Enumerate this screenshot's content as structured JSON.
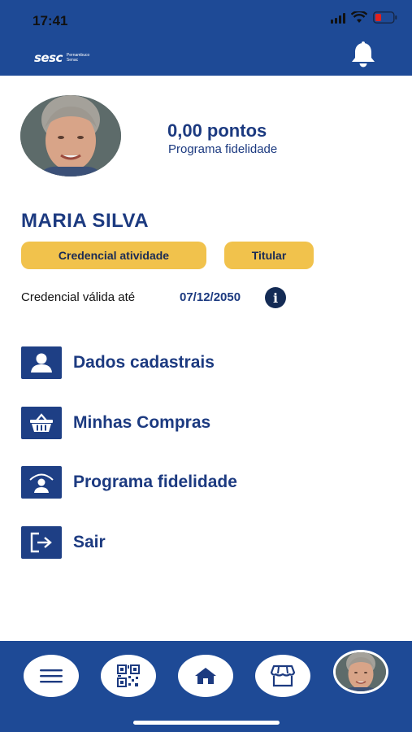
{
  "status_bar": {
    "time": "17:41"
  },
  "header": {
    "logo_word": "sesc",
    "logo_subtitle": "Pernambuco Senac"
  },
  "profile": {
    "points_value": "0,00 pontos",
    "points_label": "Programa fidelidade",
    "name": "MARIA SILVA",
    "badges": [
      "Credencial atividade",
      "Titular"
    ],
    "validity_label": "Credencial válida até",
    "validity_date": "07/12/2050",
    "info_icon": "i"
  },
  "menu": {
    "items": [
      {
        "label": "Dados cadastrais",
        "icon": "user-icon"
      },
      {
        "label": "Minhas Compras",
        "icon": "basket-icon"
      },
      {
        "label": "Programa fidelidade",
        "icon": "loyalty-icon"
      },
      {
        "label": "Sair",
        "icon": "logout-icon"
      }
    ]
  },
  "bottom_nav": {
    "items": [
      "menu-icon",
      "qr-code-icon",
      "home-icon",
      "store-icon",
      "profile-avatar"
    ]
  },
  "colors": {
    "brand_blue": "#1e4a96",
    "text_blue": "#1c3a80",
    "pill_yellow": "#f1c24c",
    "icon_dark": "#142b55"
  }
}
